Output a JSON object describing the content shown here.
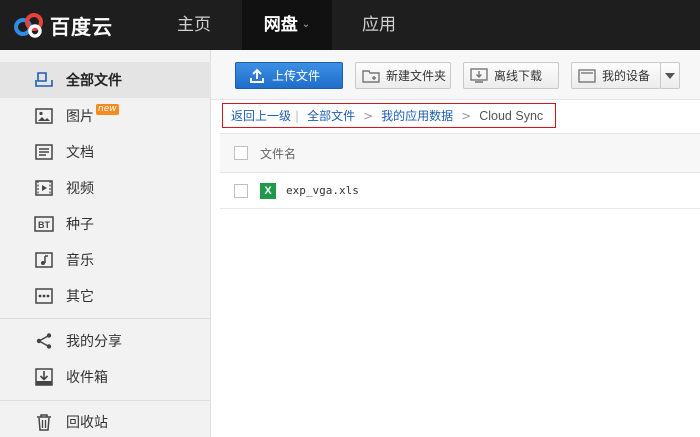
{
  "app": {
    "logo_text": "百度云"
  },
  "nav": {
    "items": [
      {
        "label": "主页"
      },
      {
        "label": "网盘",
        "chevron": "⌄"
      },
      {
        "label": "应用"
      }
    ]
  },
  "sidebar": {
    "items": [
      {
        "label": "全部文件",
        "icon": "all-files-icon",
        "active": true
      },
      {
        "label": "图片",
        "icon": "image-icon",
        "badge": "new"
      },
      {
        "label": "文档",
        "icon": "document-icon"
      },
      {
        "label": "视频",
        "icon": "video-icon"
      },
      {
        "label": "种子",
        "icon": "torrent-icon",
        "icon_text": "BT"
      },
      {
        "label": "音乐",
        "icon": "music-icon"
      },
      {
        "label": "其它",
        "icon": "other-icon"
      },
      {
        "label": "我的分享",
        "icon": "share-icon"
      },
      {
        "label": "收件箱",
        "icon": "inbox-icon"
      },
      {
        "label": "回收站",
        "icon": "trash-icon"
      }
    ]
  },
  "toolbar": {
    "upload_label": "上传文件",
    "new_folder_label": "新建文件夹",
    "offline_label": "离线下载",
    "device_label": "我的设备"
  },
  "breadcrumb": {
    "back_label": "返回上一级",
    "items": [
      "全部文件",
      "我的应用数据"
    ],
    "current": "Cloud Sync",
    "separator": ">",
    "divider": "|"
  },
  "table": {
    "header": "文件名",
    "rows": [
      {
        "name": "exp_vga.xls",
        "type_icon_text": "X"
      }
    ]
  },
  "colors": {
    "topbar_bg": "#1e1e1e",
    "accent_blue": "#1f6ecb",
    "link_blue": "#1b5fb4",
    "highlight_border": "#d9141d",
    "excel_green": "#1f9a4a",
    "badge_orange": "#f58a1f"
  }
}
